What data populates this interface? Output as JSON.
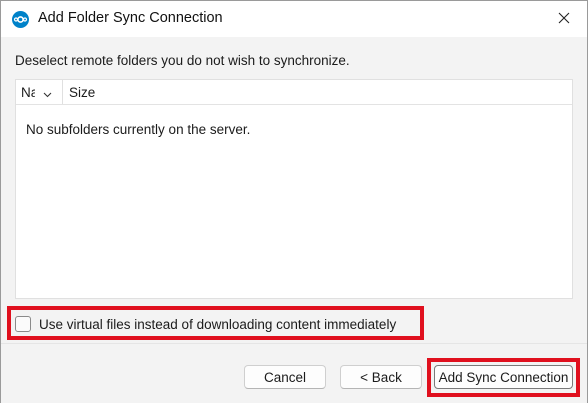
{
  "window": {
    "title": "Add Folder Sync Connection",
    "app_icon": "nextcloud-icon",
    "close_icon": "close-icon"
  },
  "main": {
    "instruction": "Deselect remote folders you do not wish to synchronize.",
    "tree": {
      "columns": [
        "Na",
        "Size"
      ],
      "sort_icon": "chevron-down-icon",
      "empty_message": "No subfolders currently on the server."
    },
    "virtual_files": {
      "label": "Use virtual files instead of downloading content immediately",
      "checked": false
    }
  },
  "footer": {
    "cancel_label": "Cancel",
    "back_label": "< Back",
    "add_label": "Add Sync Connection"
  },
  "colors": {
    "highlight": "#e0101e",
    "accent": "#0082c9"
  }
}
